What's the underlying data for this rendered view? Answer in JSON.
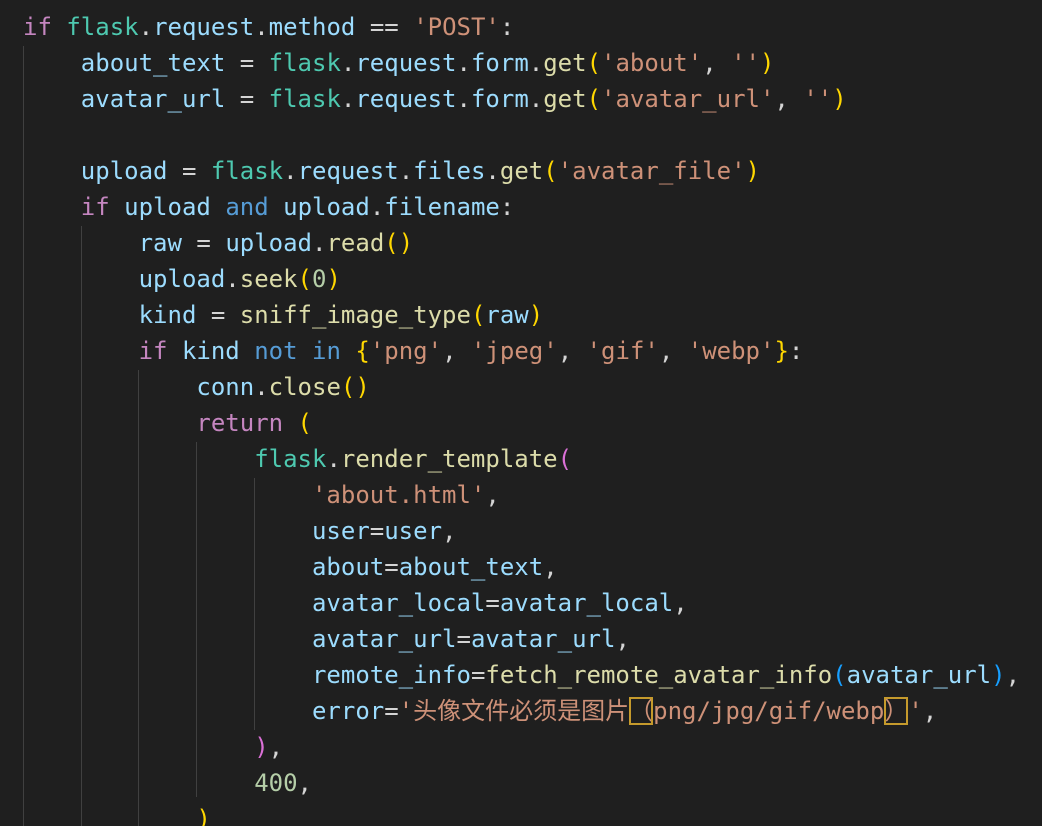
{
  "code_lines": [
    "if flask.request.method == 'POST':",
    "    about_text = flask.request.form.get('about', '')",
    "    avatar_url = flask.request.form.get('avatar_url', '')",
    "",
    "    upload = flask.request.files.get('avatar_file')",
    "    if upload and upload.filename:",
    "        raw = upload.read()",
    "        upload.seek(0)",
    "        kind = sniff_image_type(raw)",
    "        if kind not in {'png', 'jpeg', 'gif', 'webp'}:",
    "            conn.close()",
    "            return (",
    "                flask.render_template(",
    "                    'about.html',",
    "                    user=user,",
    "                    about=about_text,",
    "                    avatar_local=avatar_local,",
    "                    avatar_url=avatar_url,",
    "                    remote_info=fetch_remote_avatar_info(avatar_url),",
    "                    error='头像文件必须是图片（png/jpg/gif/webp）',",
    "                ),",
    "                400,",
    "            )"
  ],
  "tokens": {
    "if": "if",
    "flask": "flask",
    "request": "request",
    "method": "method",
    "post": "'POST'",
    "about_text": "about_text",
    "form": "form",
    "get": "get",
    "about_str": "'about'",
    "empty_str": "''",
    "avatar_url": "avatar_url",
    "avatar_url_str": "'avatar_url'",
    "upload": "upload",
    "files": "files",
    "avatar_file_str": "'avatar_file'",
    "and": "and",
    "filename": "filename",
    "raw": "raw",
    "read": "read",
    "seek": "seek",
    "zero": "0",
    "kind": "kind",
    "sniff_image_type": "sniff_image_type",
    "not": "not",
    "in": "in",
    "png_str": "'png'",
    "jpeg_str": "'jpeg'",
    "gif_str": "'gif'",
    "webp_str": "'webp'",
    "conn": "conn",
    "close": "close",
    "return": "return",
    "render_template": "render_template",
    "about_html_str": "'about.html'",
    "user": "user",
    "about": "about",
    "avatar_local": "avatar_local",
    "remote_info": "remote_info",
    "fetch_remote_avatar_info": "fetch_remote_avatar_info",
    "error": "error",
    "err_q1": "'头像文件必须是图片",
    "err_paren_open": "（",
    "err_mid": "png/jpg/gif/webp",
    "err_paren_close": "）",
    "err_q2": "'",
    "status_code": "400"
  },
  "colors": {
    "background": "#1f1f1f",
    "keyword": "#569cd6",
    "control": "#c586c0",
    "module": "#4ec9b0",
    "variable": "#9cdcfe",
    "function": "#dcdcaa",
    "string": "#ce9178",
    "number": "#b5cea8",
    "bracket_gold": "#ffd700",
    "bracket_purple": "#da70d6",
    "bracket_blue": "#179fff",
    "highlight_box": "#c59a2c",
    "indent_guide": "#404040"
  }
}
